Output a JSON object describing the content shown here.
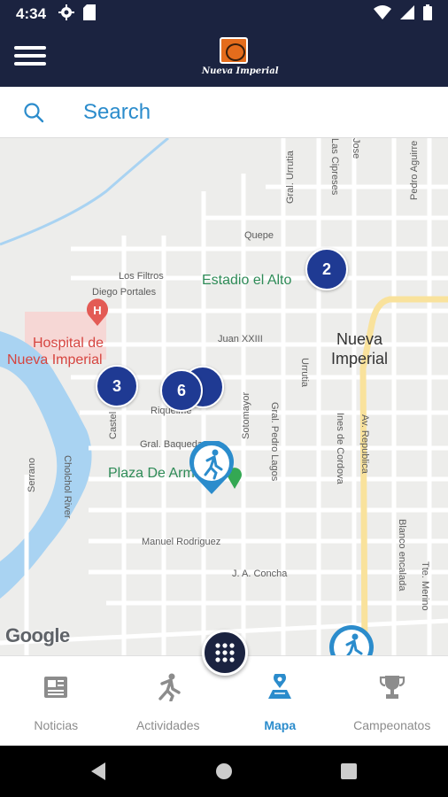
{
  "status_bar": {
    "time": "4:34",
    "left_icons": [
      "gear-icon",
      "sd-card-icon"
    ],
    "right_icons": [
      "wifi-icon",
      "signal-icon",
      "battery-icon"
    ]
  },
  "header": {
    "logo_text": "Nueva Imperial"
  },
  "search": {
    "placeholder": "Search"
  },
  "map": {
    "street_labels": [
      "Quepe",
      "Los Filtros",
      "Diego Portales",
      "Juan XXIII",
      "Gral. Baquedano",
      "Riquelme",
      "Manuel Rodriguez",
      "J. A. Concha",
      "Castel",
      "Serrano",
      "Cholchol River",
      "Sotomayor",
      "Gral. Pedro Lagos",
      "Ines de Cordova",
      "Av. Republica",
      "Blanco encalada",
      "Tte. Merino",
      "Urrutia",
      "Gral. Urrutia",
      "Las Cipreses",
      "Jose",
      "Pedro Aguirre"
    ],
    "pois": {
      "stadium": "Estadio el Alto",
      "hospital_line1": "Hospital de",
      "hospital_line2": "Nueva Imperial",
      "plaza": "Plaza De Armas",
      "town_line1": "Nueva",
      "town_line2": "Imperial"
    },
    "clusters": [
      "2",
      "3",
      "6"
    ],
    "attribution": "Google",
    "colors": {
      "cluster": "#1f3a93",
      "pin": "#2b8ccc",
      "river": "#a9d3f2",
      "highway": "#f9e29c"
    }
  },
  "bottom_nav": {
    "items": [
      {
        "label": "Noticias",
        "icon": "newspaper-icon",
        "active": false
      },
      {
        "label": "Actividades",
        "icon": "running-person-icon",
        "active": false
      },
      {
        "label": "Mapa",
        "icon": "map-pin-icon",
        "active": true
      },
      {
        "label": "Campeonatos",
        "icon": "trophy-icon",
        "active": false
      }
    ],
    "accent": "#2b8ccc",
    "inactive": "#8c8c8c"
  },
  "fab_icon": "grid-menu-icon"
}
